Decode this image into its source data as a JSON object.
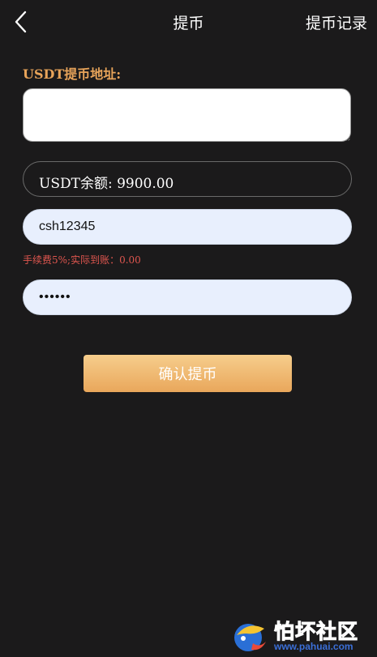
{
  "header": {
    "title": "提币",
    "records_label": "提币记录",
    "back_icon": "chevron-left-icon"
  },
  "form": {
    "address_label": "USDT提币地址:",
    "address_value": "",
    "balance_text": "USDT余额: 9900.00",
    "amount_value": "csh12345",
    "fee_text": "手续费5%;实际到账：0.00",
    "password_value": "••••••",
    "submit_label": "确认提币"
  },
  "colors": {
    "background": "#1b1a1b",
    "label_gold": "#e8a45a",
    "fee_red": "#e0564f",
    "button_top": "#f6cd8c",
    "button_bottom": "#e9a75b",
    "input_fill": "#e8effd"
  },
  "watermark": {
    "name": "怕坏社区",
    "url": "www.pahuai.com"
  }
}
